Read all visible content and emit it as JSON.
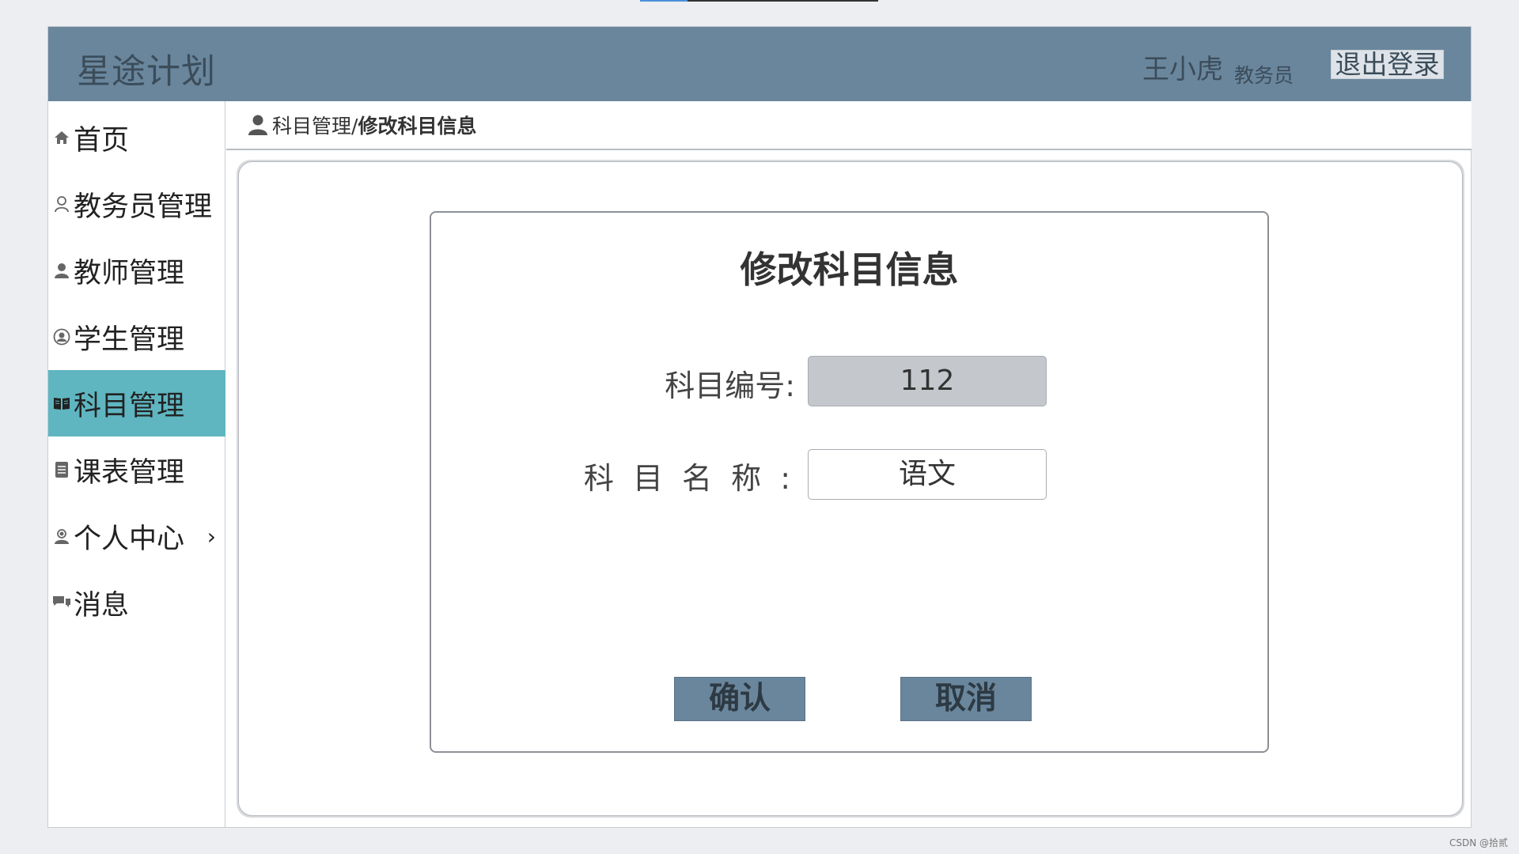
{
  "app": {
    "title": "星途计划"
  },
  "header": {
    "user_name": "王小虎",
    "user_role": "教务员",
    "logout_label": "退出登录"
  },
  "sidebar": {
    "items": [
      {
        "label": "首页",
        "icon": "home-icon"
      },
      {
        "label": "教务员管理",
        "icon": "user-outline-icon"
      },
      {
        "label": "教师管理",
        "icon": "user-icon"
      },
      {
        "label": "学生管理",
        "icon": "user-circle-icon"
      },
      {
        "label": "科目管理",
        "icon": "book-icon",
        "active": true
      },
      {
        "label": "课表管理",
        "icon": "document-icon"
      },
      {
        "label": "个人中心",
        "icon": "user-badge-icon",
        "has_submenu": true
      },
      {
        "label": "消息",
        "icon": "chat-icon"
      }
    ]
  },
  "breadcrumb": {
    "parent": "科目管理/",
    "current": "修改科目信息"
  },
  "form": {
    "title": "修改科目信息",
    "code_label": "科目编号:",
    "code_value": "112",
    "name_label": "科 目 名 称 :",
    "name_value": "语文",
    "confirm_label": "确认",
    "cancel_label": "取消"
  },
  "watermark": "CSDN @拾贰",
  "colors": {
    "header_bg": "#6a869c",
    "active_nav": "#5fb6c1",
    "button_bg": "#6a869c"
  }
}
